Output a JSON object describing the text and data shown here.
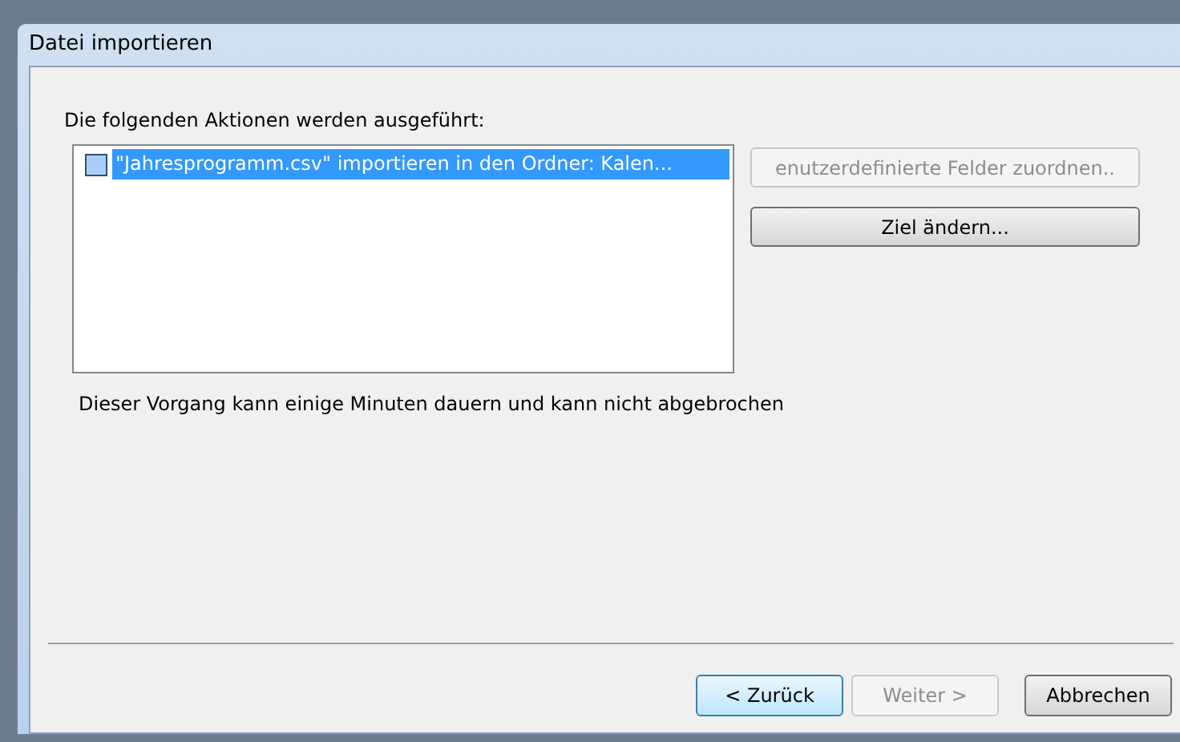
{
  "window": {
    "title": "Datei importieren"
  },
  "actions_label": "Die folgenden Aktionen werden ausgeführt:",
  "actions": [
    {
      "label": "\"Jahresprogramm.csv\" importieren in den Ordner: Kalen...",
      "checked": false,
      "selected": true
    }
  ],
  "side_buttons": [
    {
      "label": "enutzerdefinierte Felder zuordnen..",
      "disabled": true
    },
    {
      "label": "Ziel ändern...",
      "disabled": false
    }
  ],
  "message": "Dieser Vorgang kann einige Minuten dauern und kann nicht abgebrochen",
  "nav_buttons": [
    {
      "label": "< Zurück",
      "disabled": false,
      "default": true
    },
    {
      "label": "Weiter >",
      "disabled": true,
      "default": false
    },
    {
      "label": "Abbrechen",
      "disabled": false,
      "default": false
    }
  ]
}
